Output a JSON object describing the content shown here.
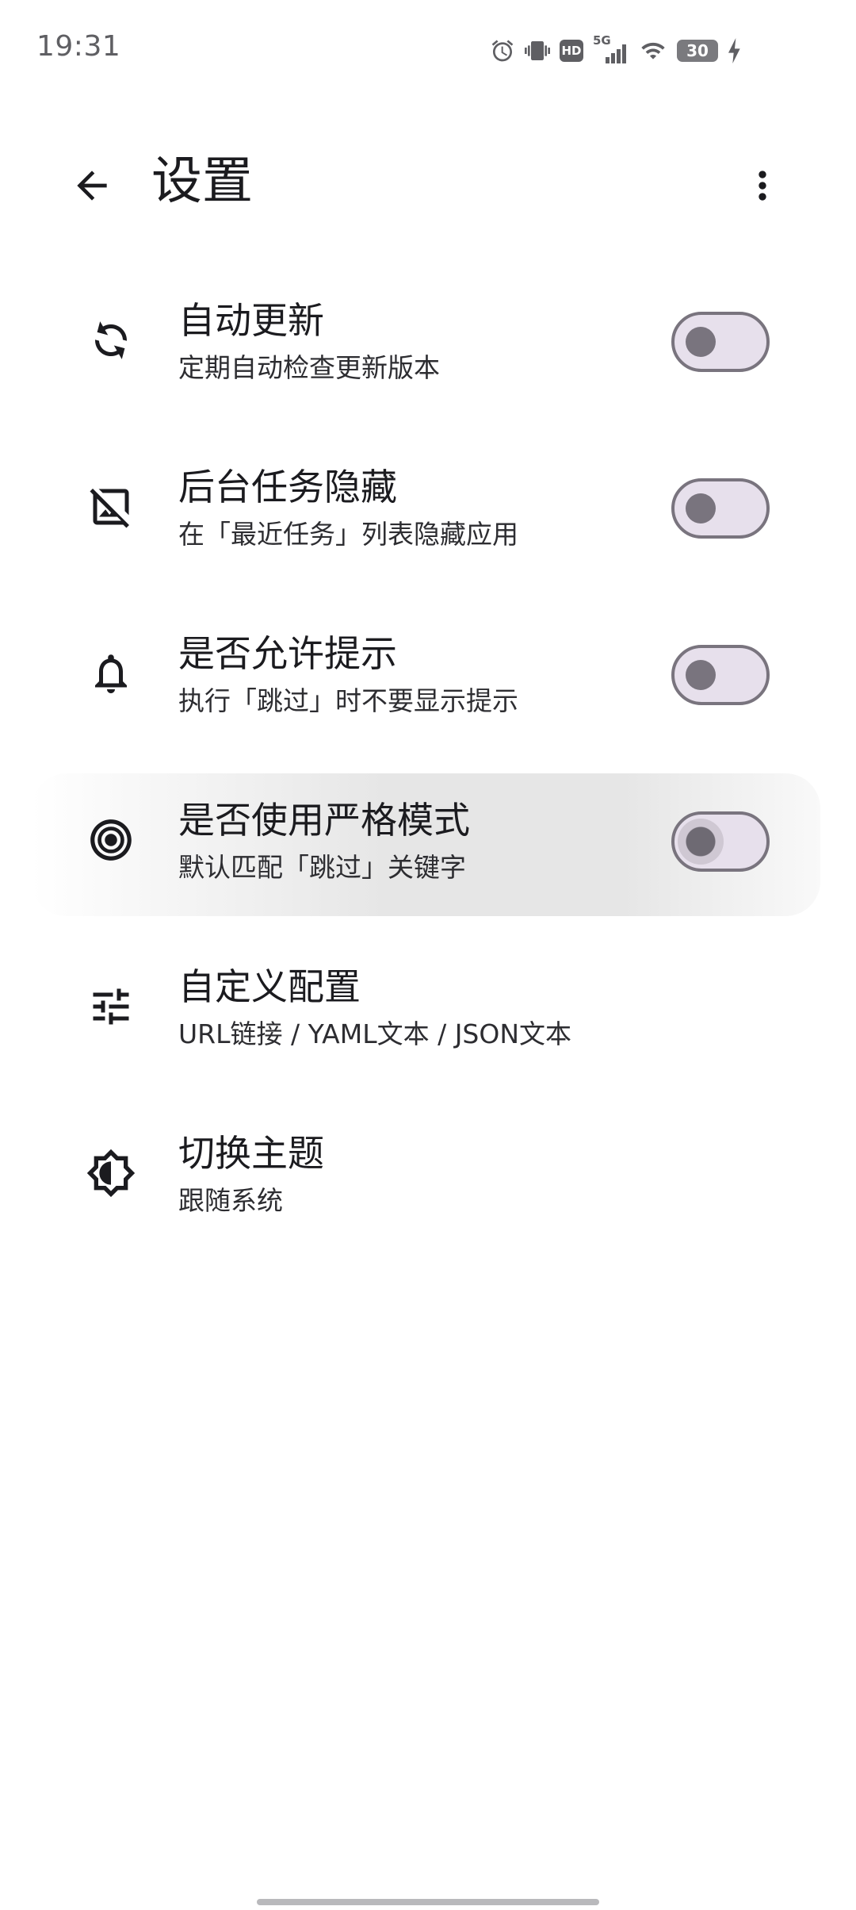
{
  "status_bar": {
    "time": "19:31",
    "network_label": "5G",
    "hd_label": "HD",
    "battery_level": "30",
    "icons": [
      "alarm-icon",
      "vibrate-icon",
      "hd-icon",
      "signal-5g-icon",
      "wifi-icon",
      "battery-icon",
      "charging-icon"
    ]
  },
  "app_bar": {
    "title": "设置",
    "back_icon": "arrow-back-icon",
    "more_icon": "more-vert-icon"
  },
  "settings": [
    {
      "id": "auto-update",
      "icon": "sync-icon",
      "title": "自动更新",
      "subtitle": "定期自动检查更新版本",
      "toggle": true,
      "checked": false
    },
    {
      "id": "hide-task",
      "icon": "hide-image-icon",
      "title": "后台任务隐藏",
      "subtitle": "在「最近任务」列表隐藏应用",
      "toggle": true,
      "checked": false
    },
    {
      "id": "allow-hint",
      "icon": "bell-icon",
      "title": "是否允许提示",
      "subtitle": "执行「跳过」时不要显示提示",
      "toggle": true,
      "checked": false
    },
    {
      "id": "strict-mode",
      "icon": "target-icon",
      "title": "是否使用严格模式",
      "subtitle": "默认匹配「跳过」关键字",
      "toggle": true,
      "checked": false
    },
    {
      "id": "custom-config",
      "icon": "tune-icon",
      "title": "自定义配置",
      "subtitle": "URL链接 / YAML文本 / JSON文本",
      "toggle": false
    },
    {
      "id": "switch-theme",
      "icon": "brightness-icon",
      "title": "切换主题",
      "subtitle": "跟随系统",
      "toggle": false
    }
  ],
  "colors": {
    "text_primary": "#1b1b1f",
    "toggle_outline": "#79747e",
    "toggle_track": "#e7e0ec"
  }
}
